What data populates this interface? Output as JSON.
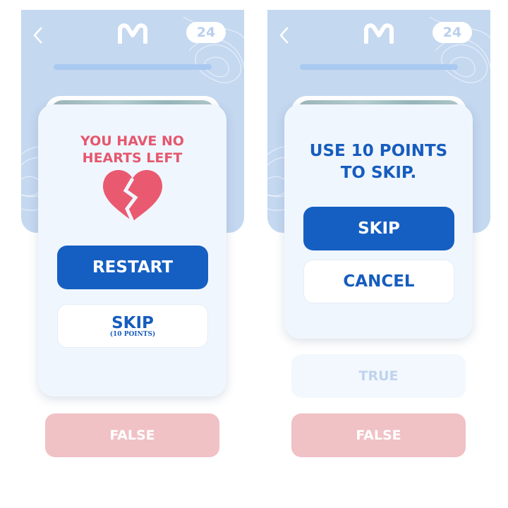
{
  "colors": {
    "hero_bg": "#c4d8f0",
    "primary": "#155fc2",
    "danger_text": "#e5576e",
    "heart": "#e95a70",
    "false_button": "#f0c1c5",
    "true_button": "#f3f8fe"
  },
  "screens": [
    {
      "header": {
        "back_icon": "chevron-left-icon",
        "logo_icon": "m-logo-icon",
        "counter": "24"
      },
      "progress": {
        "fraction": 1.0
      },
      "modal": {
        "message_line1": "YOU HAVE NO",
        "message_line2": "HEARTS LEFT",
        "icon": "broken-heart-icon",
        "primary_label": "RESTART",
        "secondary_label": "SKIP",
        "secondary_sublabel": "(10 POINTS)"
      },
      "answer_false": "FALSE"
    },
    {
      "header": {
        "back_icon": "chevron-left-icon",
        "logo_icon": "m-logo-icon",
        "counter": "24"
      },
      "progress": {
        "fraction": 1.0
      },
      "modal": {
        "message_line1": "USE 10 POINTS",
        "message_line2": "TO SKIP.",
        "primary_label": "SKIP",
        "secondary_label": "CANCEL"
      },
      "answer_true": "TRUE",
      "answer_false": "FALSE"
    }
  ]
}
